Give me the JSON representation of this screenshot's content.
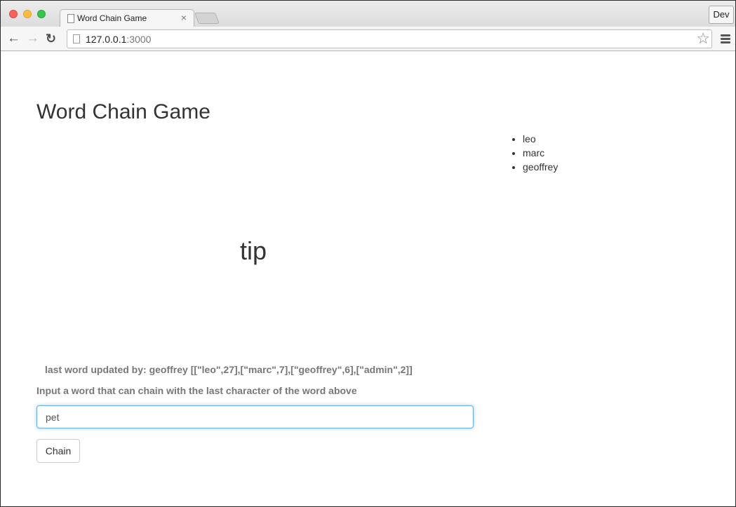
{
  "browser": {
    "tab_title": "Word Chain Game",
    "tab_close": "×",
    "dev_label": "Dev",
    "url_host": "127.0.0.1",
    "url_port": ":3000",
    "back_icon": "←",
    "forward_icon": "→",
    "reload_icon": "↻",
    "star_icon": "☆"
  },
  "page": {
    "title": "Word Chain Game",
    "players": [
      "leo",
      "marc",
      "geoffrey"
    ],
    "current_word": "tip",
    "status": "last word updated by: geoffrey [[\"leo\",27],[\"marc\",7],[\"geoffrey\",6],[\"admin\",2]]",
    "instruction": "Input a word that can chain with the last character of the word above",
    "input_value": "pet",
    "submit_label": "Chain"
  },
  "colors": {
    "input_focus_border": "#66afe9",
    "muted_text": "#777777",
    "heading_text": "#333333"
  }
}
